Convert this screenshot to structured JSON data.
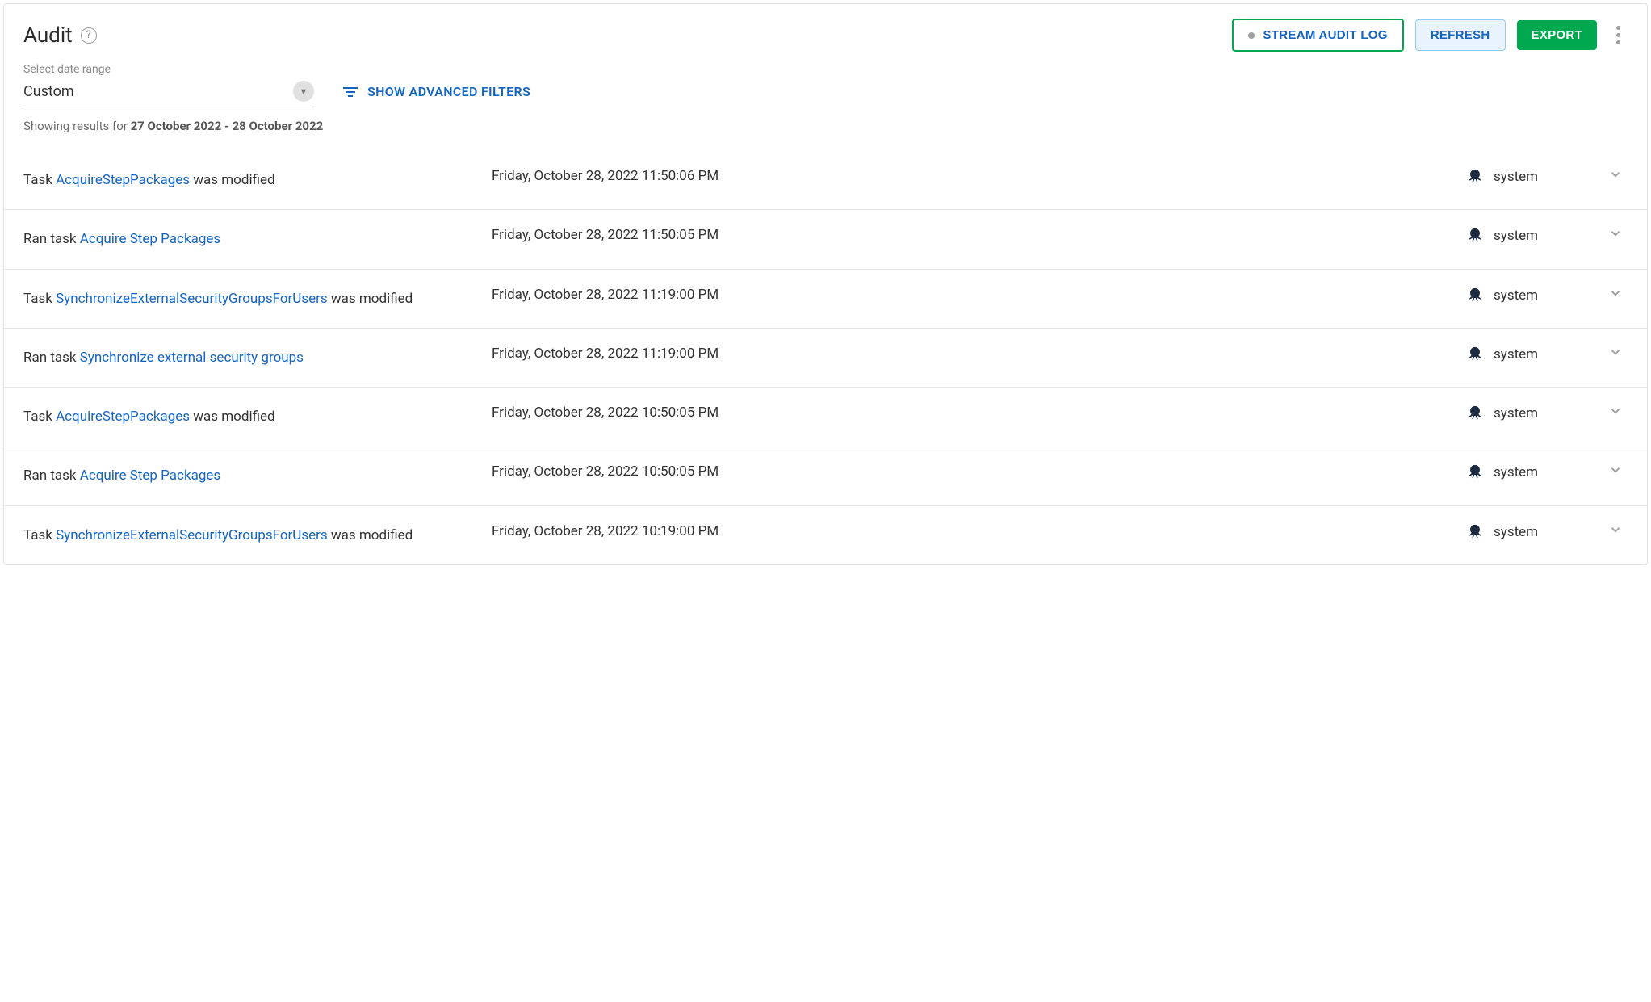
{
  "header": {
    "title": "Audit",
    "help_glyph": "?",
    "buttons": {
      "stream": "STREAM AUDIT LOG",
      "refresh": "REFRESH",
      "export": "EXPORT"
    }
  },
  "filters": {
    "date_range_label": "Select date range",
    "date_range_value": "Custom",
    "advanced_label": "SHOW ADVANCED FILTERS"
  },
  "results": {
    "prefix": "Showing results for ",
    "range": "27 October 2022 - 28 October 2022"
  },
  "rows": [
    {
      "pre": "Task ",
      "link": "AcquireStepPackages",
      "post": " was modified",
      "date": "Friday, October 28, 2022 11:50:06 PM",
      "user": "system"
    },
    {
      "pre": "Ran task ",
      "link": "Acquire Step Packages",
      "post": "",
      "date": "Friday, October 28, 2022 11:50:05 PM",
      "user": "system"
    },
    {
      "pre": "Task ",
      "link": "SynchronizeExternalSecurityGroupsForUsers",
      "post": " was modified",
      "date": "Friday, October 28, 2022 11:19:00 PM",
      "user": "system"
    },
    {
      "pre": "Ran task ",
      "link": "Synchronize external security groups",
      "post": "",
      "date": "Friday, October 28, 2022 11:19:00 PM",
      "user": "system"
    },
    {
      "pre": "Task ",
      "link": "AcquireStepPackages",
      "post": " was modified",
      "date": "Friday, October 28, 2022 10:50:05 PM",
      "user": "system"
    },
    {
      "pre": "Ran task ",
      "link": "Acquire Step Packages",
      "post": "",
      "date": "Friday, October 28, 2022 10:50:05 PM",
      "user": "system"
    },
    {
      "pre": "Task ",
      "link": "SynchronizeExternalSecurityGroupsForUsers",
      "post": " was modified",
      "date": "Friday, October 28, 2022 10:19:00 PM",
      "user": "system"
    }
  ]
}
